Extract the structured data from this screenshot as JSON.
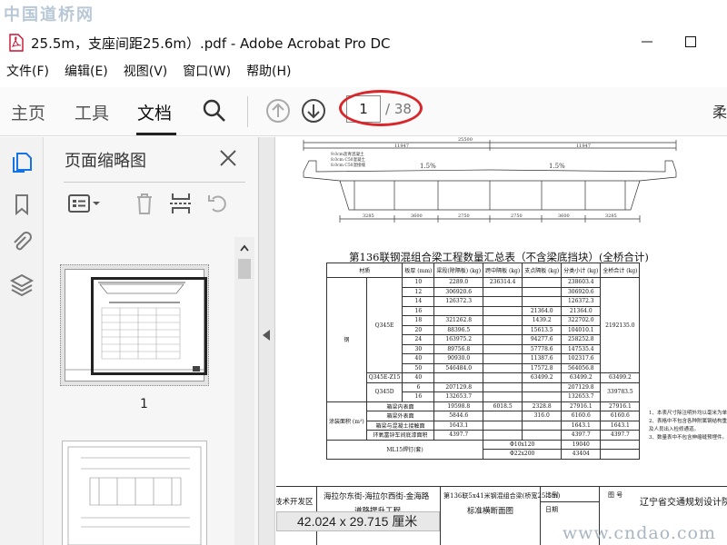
{
  "watermarks": {
    "top": "中国道桥网",
    "bottom": "www.cndao.com"
  },
  "window": {
    "title": "25.5m，支座间距25.6m）.pdf - Adobe Acrobat Pro DC"
  },
  "menu": [
    "文件(F)",
    "编辑(E)",
    "视图(V)",
    "窗口(W)",
    "帮助(H)"
  ],
  "toolbar": {
    "tabs": [
      "主页",
      "工具",
      "文档"
    ],
    "active_tab": "文档",
    "current_page": "1",
    "total_pages": "/ 38",
    "right_edge_glyph": "柔"
  },
  "panel": {
    "title": "页面缩略图",
    "thumb1_label": "1"
  },
  "document": {
    "cross_section": {
      "dims_top": [
        "25500",
        "11947",
        "11947"
      ],
      "labels": [
        "9.0cm沥青混凝土",
        "8.0cm C50混凝土",
        "8.0cm C50湿接缝"
      ],
      "slopes": [
        "1.5%",
        "1.5%"
      ],
      "dims_bottom": [
        "3285",
        "3600",
        "2750",
        "2750",
        "3600",
        "3285"
      ]
    },
    "table_title": "第136联钢混组合梁工程数量汇总表（不含梁底挡块）(全桥合计)",
    "table_headers": [
      "材质",
      "板厚 (mm)",
      "梁段(除隔板) (kg)",
      "跨中隔板 (kg)",
      "支点隔板 (kg)",
      "分类小计 (kg)",
      "全桥合计 (kg)"
    ],
    "material_groups": [
      "钢",
      "材",
      "Q345E",
      "Q345E-Z15",
      "Q345D"
    ],
    "table_rows": [
      [
        "10",
        "2289.0",
        "236314.4",
        "",
        "238603.4"
      ],
      [
        "12",
        "306920.6",
        "",
        "",
        "306920.6"
      ],
      [
        "14",
        "126372.3",
        "",
        "",
        "126372.3"
      ],
      [
        "16",
        "",
        "",
        "21364.0",
        "21364.0"
      ],
      [
        "18",
        "321262.8",
        "",
        "1439.2",
        "322702.0"
      ],
      [
        "20",
        "88396.5",
        "",
        "15613.5",
        "104010.1"
      ],
      [
        "24",
        "163975.2",
        "",
        "94277.6",
        "258252.8"
      ],
      [
        "30",
        "89756.8",
        "",
        "57778.6",
        "147535.4"
      ],
      [
        "40",
        "90930.0",
        "",
        "11387.6",
        "102317.6"
      ],
      [
        "50",
        "546484.0",
        "",
        "17572.8",
        "564056.8"
      ],
      [
        "40",
        "",
        "",
        "63499.2",
        "63499.2"
      ],
      [
        "6",
        "207129.8",
        "",
        "",
        "207129.8"
      ],
      [
        "16",
        "132653.7",
        "",
        "",
        "132653.7"
      ]
    ],
    "grand_totals": [
      "2192135.0",
      "63499.2",
      "339783.5"
    ],
    "coating_label": "涂装面积 (m²)",
    "coating_rows": [
      [
        "箱梁内表面",
        "19598.8",
        "6018.5",
        "2328.8",
        "27916.1",
        "27916.1"
      ],
      [
        "箱梁外表面",
        "5844.6",
        "",
        "316.0",
        "6160.6",
        "6160.6"
      ],
      [
        "箱梁与混凝土接触面",
        "1643.1",
        "",
        "",
        "1643.1",
        "1643.1"
      ],
      [
        "环氧富锌车间底漆面积",
        "4397.7",
        "",
        "",
        "4397.7",
        "4397.7"
      ]
    ],
    "stud_rows": [
      [
        "ML15焊钉(套)",
        "Φ10x120",
        "19040"
      ],
      [
        "",
        "Φ22x200",
        "43404"
      ]
    ],
    "notes": [
      "1、本表尺寸除注明外均以毫米为单位。",
      "2、表格中不包含各种附属钢结构重量，",
      "    及人员出入检修通道。",
      "3、数量表中不包含伸缩缝预埋件。"
    ],
    "title_block": {
      "left": "技术开发区",
      "project_line1": "海拉尔东街-海拉尔西街-金海路",
      "project_line2": "道路提升工程",
      "drawing_line1": "第136联5x41米钢混组合梁(桥宽25.5m)",
      "drawing_line2": "标准横断面图",
      "scale_label": "比例",
      "scale_sub": "日期",
      "sheet_label": "图 号",
      "institute": "辽宁省交通规划设计院"
    },
    "page_dimensions": "42.024 x 29.715 厘米"
  }
}
